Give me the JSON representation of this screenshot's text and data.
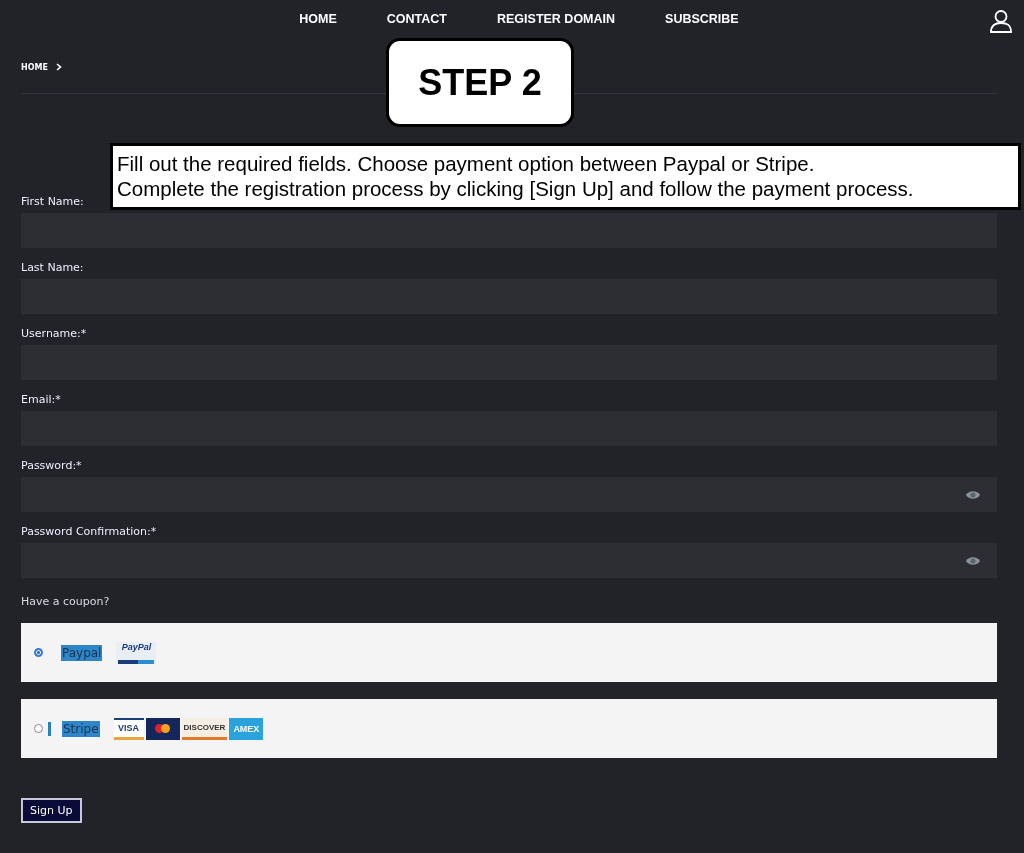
{
  "nav": {
    "items": [
      {
        "label": "HOME"
      },
      {
        "label": "CONTACT"
      },
      {
        "label": "REGISTER DOMAIN"
      },
      {
        "label": "SUBSCRIBE"
      }
    ]
  },
  "breadcrumb": [
    {
      "label": "HOME"
    }
  ],
  "step_badge": "STEP 2",
  "instructions": [
    "Fill out the required fields. Choose payment option between Paypal or Stripe.",
    "Complete the registration process by clicking [Sign Up] and follow the payment process."
  ],
  "fields": [
    {
      "label": "First Name:",
      "kind": "text"
    },
    {
      "label": "Last Name:",
      "kind": "text"
    },
    {
      "label": "Username:*",
      "kind": "text"
    },
    {
      "label": "Email:*",
      "kind": "text"
    },
    {
      "label": "Password:*",
      "kind": "password"
    },
    {
      "label": "Password Confirmation:*",
      "kind": "password"
    }
  ],
  "coupon_link": "Have a coupon?",
  "payment_options": [
    {
      "name": "Paypal",
      "selected": true,
      "marker": false,
      "cards": [
        {
          "kind": "paypal",
          "text": "PayPal"
        }
      ]
    },
    {
      "name": "Stripe",
      "selected": false,
      "marker": true,
      "cards": [
        {
          "kind": "visa",
          "text": "VISA"
        },
        {
          "kind": "mastercard"
        },
        {
          "kind": "discover",
          "text": "DISCOVER"
        },
        {
          "kind": "amex",
          "text": "AMEX"
        }
      ]
    }
  ],
  "submit_button": "Sign Up"
}
